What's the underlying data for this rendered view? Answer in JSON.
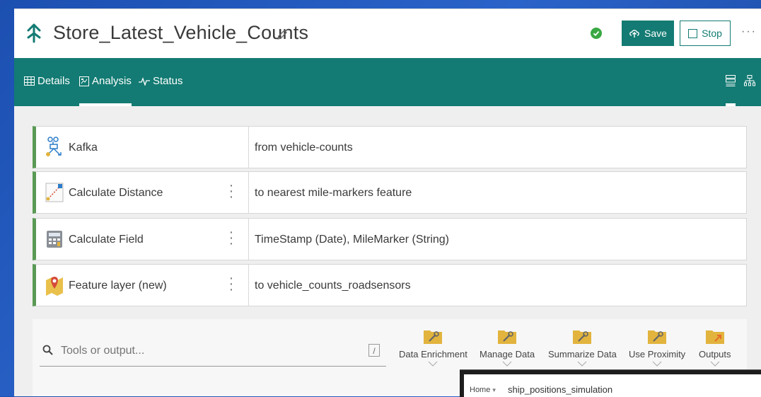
{
  "header": {
    "title": "Store_Latest_Vehicle_Counts",
    "save_label": "Save",
    "stop_label": "Stop",
    "more_label": "···"
  },
  "tabs": [
    {
      "label": "Details",
      "icon": "table-icon"
    },
    {
      "label": "Analysis",
      "icon": "analysis-icon",
      "active": true
    },
    {
      "label": "Status",
      "icon": "pulse-icon"
    }
  ],
  "pipeline": [
    {
      "name": "Kafka",
      "description": "from vehicle-counts",
      "icon": "kafka-icon"
    },
    {
      "name": "Calculate Distance",
      "description": "to nearest mile-markers feature",
      "icon": "distance-icon"
    },
    {
      "name": "Calculate Field",
      "description": "TimeStamp (Date), MileMarker (String)",
      "icon": "calculator-icon"
    },
    {
      "name": "Feature layer (new)",
      "description": "to vehicle_counts_roadsensors",
      "icon": "map-pin-icon"
    }
  ],
  "toolbox": {
    "search_placeholder": "Tools or output...",
    "shortcut": "/",
    "tools": [
      "Data Enrichment",
      "Manage Data",
      "Summarize Data",
      "Use Proximity",
      "Outputs"
    ]
  },
  "popup": {
    "home_label": "Home",
    "title": "ship_positions_simulation"
  },
  "colors": {
    "brand": "#137b73",
    "status_ok": "#3aa843",
    "row_accent": "#5a9a55",
    "folder": "#e2b43e"
  }
}
